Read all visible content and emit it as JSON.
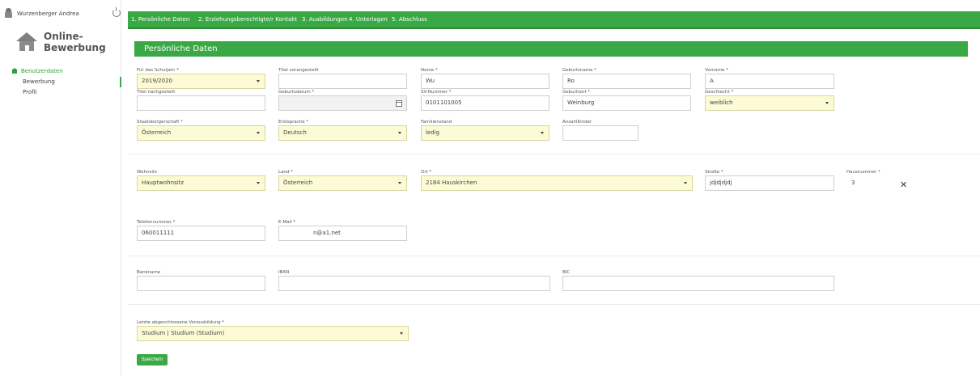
{
  "user": {
    "name": "Wurzenberger Andrea"
  },
  "logo": {
    "line1": "Online-",
    "line2": "Bewerbung"
  },
  "nav": {
    "section": "Benutzerdaten",
    "items": [
      "Bewerbung",
      "Profil"
    ]
  },
  "tabs": [
    "1. Persönliche Daten",
    "2. Erziehungsberechtigte/r Kontakt",
    "3. Ausbildungen",
    "4. Unterlagen",
    "5. Abschluss"
  ],
  "section": {
    "title": "Persönliche Daten"
  },
  "fields": {
    "schuljahr": {
      "label": "Für das Schuljahr *",
      "value": "2019/2020"
    },
    "titel_vor": {
      "label": "Titel vorangestellt",
      "value": ""
    },
    "name": {
      "label": "Name *",
      "value": "Wu"
    },
    "geburtsname": {
      "label": "Geburtsname *",
      "value": "Ro"
    },
    "vorname": {
      "label": "Vorname *",
      "value": "A"
    },
    "titel_nach": {
      "label": "Titel nachgestellt",
      "value": ""
    },
    "geburtsdatum": {
      "label": "Geburtsdatum *",
      "value": ""
    },
    "sv_nummer": {
      "label": "SV-Nummer *",
      "value": "0101101005"
    },
    "geburtsort": {
      "label": "Geburtsort *",
      "value": "Weinburg"
    },
    "geschlecht": {
      "label": "Geschlecht *",
      "value": "weiblich"
    },
    "staatsbuergerschaft": {
      "label": "Staatsbürgerschaft *",
      "value": "Österreich"
    },
    "erstsprache": {
      "label": "Erstsprache *",
      "value": "Deutsch"
    },
    "familienstand": {
      "label": "Familienstand",
      "value": "ledig"
    },
    "anzahl_kinder": {
      "label": "AnzahlKinder",
      "value": ""
    },
    "wohnsitz": {
      "label": "Wohnsitz",
      "value": "Hauptwohnsitz"
    },
    "land": {
      "label": "Land *",
      "value": "Österreich"
    },
    "ort": {
      "label": "Ort *",
      "value": "2184 Hauskirchen"
    },
    "strasse": {
      "label": "Straße *",
      "value": "jdjdjdjdj"
    },
    "hausnummer": {
      "label": "Hausnummer *",
      "value": "3"
    },
    "telefon": {
      "label": "Telefonnummer *",
      "value": "060011111"
    },
    "email": {
      "label": "E-Mail *",
      "value": "n@a1.net"
    },
    "bankname": {
      "label": "Bankname",
      "value": ""
    },
    "iban": {
      "label": "IBAN",
      "value": ""
    },
    "bic": {
      "label": "BIC",
      "value": ""
    },
    "vorausbildung": {
      "label": "Letzte abgeschlossene Vorausbildung *",
      "value": "Studium | Studium (Studium)"
    }
  },
  "buttons": {
    "save": "Speichern",
    "clear": "✕"
  },
  "colors": {
    "accent": "#3aa845",
    "required_bg": "#fdfbd6"
  }
}
